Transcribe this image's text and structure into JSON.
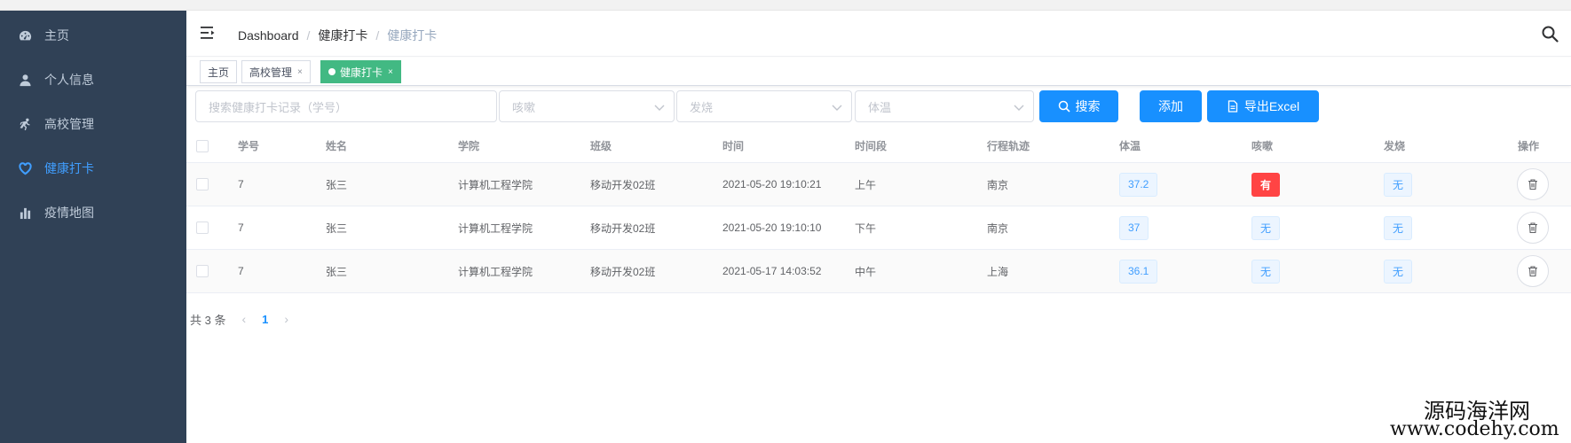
{
  "sidebar": {
    "items": [
      {
        "label": "主页",
        "icon": "dashboard-icon"
      },
      {
        "label": "个人信息",
        "icon": "user-icon"
      },
      {
        "label": "高校管理",
        "icon": "runner-icon"
      },
      {
        "label": "健康打卡",
        "icon": "heart-icon",
        "active": true
      },
      {
        "label": "疫情地图",
        "icon": "bar-chart-icon"
      }
    ]
  },
  "navbar": {
    "breadcrumb": [
      "Dashboard",
      "健康打卡",
      "健康打卡"
    ]
  },
  "tags": [
    {
      "label": "主页"
    },
    {
      "label": "高校管理",
      "close": "×"
    },
    {
      "label": "健康打卡",
      "close": "×",
      "active": true
    }
  ],
  "filters": {
    "search_placeholder": "搜索健康打卡记录（学号）",
    "cough_placeholder": "咳嗽",
    "fever_placeholder": "发烧",
    "temp_placeholder": "体温"
  },
  "buttons": {
    "search": "搜索",
    "add": "添加",
    "export": "导出Excel"
  },
  "table": {
    "columns": [
      "学号",
      "姓名",
      "学院",
      "班级",
      "时间",
      "时间段",
      "行程轨迹",
      "体温",
      "咳嗽",
      "发烧",
      "操作"
    ],
    "rows": [
      {
        "id": "7",
        "name": "张三",
        "college": "计算机工程学院",
        "class": "移动开发02班",
        "time": "2021-05-20 19:10:21",
        "period": "上午",
        "trip": "南京",
        "temp": "37.2",
        "cough": "有",
        "fever": "无"
      },
      {
        "id": "7",
        "name": "张三",
        "college": "计算机工程学院",
        "class": "移动开发02班",
        "time": "2021-05-20 19:10:10",
        "period": "下午",
        "trip": "南京",
        "temp": "37",
        "cough": "无",
        "fever": "无"
      },
      {
        "id": "7",
        "name": "张三",
        "college": "计算机工程学院",
        "class": "移动开发02班",
        "time": "2021-05-17 14:03:52",
        "period": "中午",
        "trip": "上海",
        "temp": "36.1",
        "cough": "无",
        "fever": "无"
      }
    ]
  },
  "pagination": {
    "total": "共 3 条",
    "prev": "‹",
    "page": "1",
    "next": "›"
  },
  "watermark": {
    "line1": "源码海洋网",
    "line2": "www.codehy.com"
  },
  "colors": {
    "sidebar_bg": "#304156",
    "primary": "#1890ff",
    "active_tag": "#42b983",
    "danger": "#ff4444"
  }
}
